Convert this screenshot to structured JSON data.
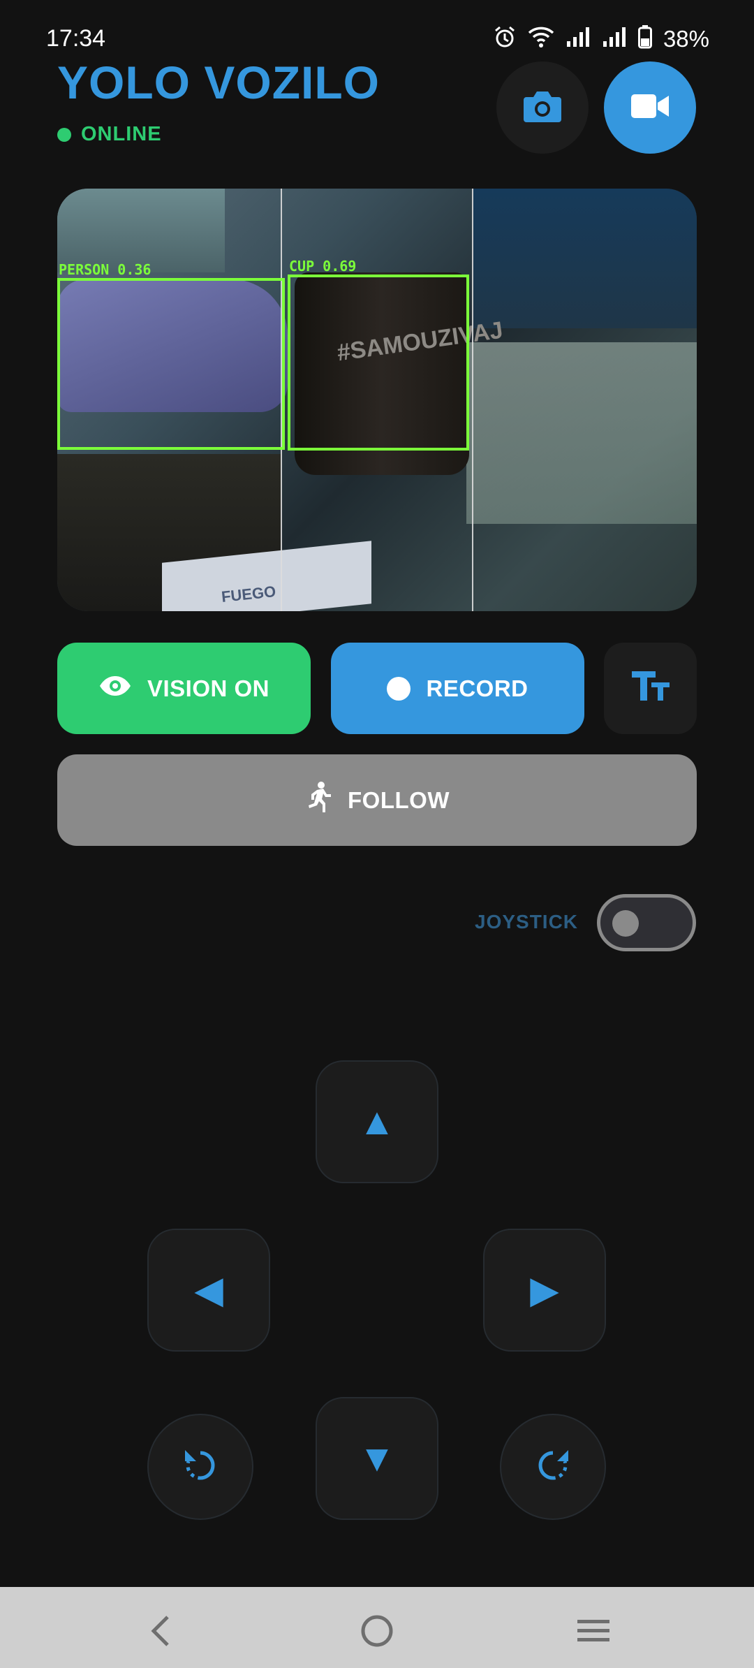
{
  "status_bar": {
    "time": "17:34",
    "battery_percent": "38%",
    "icons": [
      "alarm-icon",
      "wifi-icon",
      "signal-icon",
      "signal-icon",
      "battery-icon"
    ]
  },
  "header": {
    "title": "YOLO VOZILO",
    "status": "ONLINE",
    "status_color": "#2ecc71",
    "accent_color": "#3597de",
    "photo_button_icon": "camera-icon",
    "video_button_icon": "video-camera-icon"
  },
  "camera_feed": {
    "detections": [
      {
        "label": "PERSON 0.36"
      },
      {
        "label": "CUP 0.69"
      }
    ],
    "cup_print": "#SAMOUZIVAJ",
    "box_print": "FUEGO"
  },
  "controls": {
    "vision_label": "VISION ON",
    "vision_icon": "eye-icon",
    "record_label": "RECORD",
    "record_icon": "record-dot-icon",
    "text_size_icon": "text-size-icon",
    "follow_label": "FOLLOW",
    "follow_icon": "running-person-icon"
  },
  "joystick": {
    "label": "JOYSTICK",
    "enabled": false
  },
  "dpad": {
    "up_glyph": "▲",
    "down_glyph": "▼",
    "left_glyph": "◀",
    "right_glyph": "▶",
    "rotate_left_icon": "rotate-left-icon",
    "rotate_right_icon": "rotate-right-icon"
  },
  "nav_bar": {
    "items": [
      "back-icon",
      "home-icon",
      "recents-icon"
    ]
  }
}
